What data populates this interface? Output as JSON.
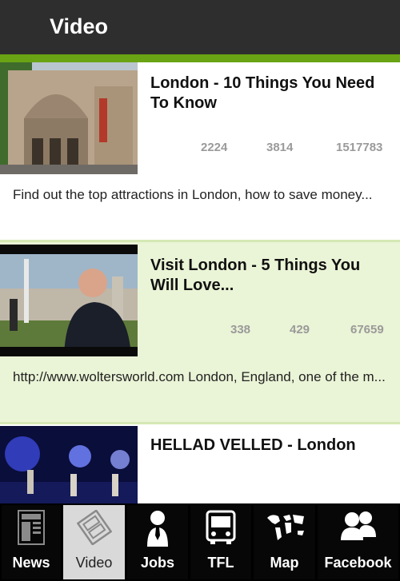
{
  "header": {
    "title": "Video"
  },
  "videos": [
    {
      "title": "London - 10 Things You Need To Know",
      "stats": [
        "2224",
        "3814",
        "1517783"
      ],
      "description": "Find out the top attractions in London, how to save money..."
    },
    {
      "title": "Visit London - 5 Things You Will Love...",
      "stats": [
        "338",
        "429",
        "67659"
      ],
      "description": "http://www.woltersworld.com London, England, one of the m..."
    },
    {
      "title": "HELLAD VELLED - London"
    }
  ],
  "tabs": [
    {
      "label": "News",
      "icon": "newspaper-icon"
    },
    {
      "label": "Video",
      "icon": "film-icon"
    },
    {
      "label": "Jobs",
      "icon": "person-tie-icon"
    },
    {
      "label": "TFL",
      "icon": "bus-icon"
    },
    {
      "label": "Map",
      "icon": "world-map-icon"
    },
    {
      "label": "Facebook",
      "icon": "people-icon"
    }
  ],
  "colors": {
    "header": "#2e2e2e",
    "accent": "#6aa313",
    "alt_row": "#eaf4d6",
    "active_tab": "#d9d9d9"
  }
}
